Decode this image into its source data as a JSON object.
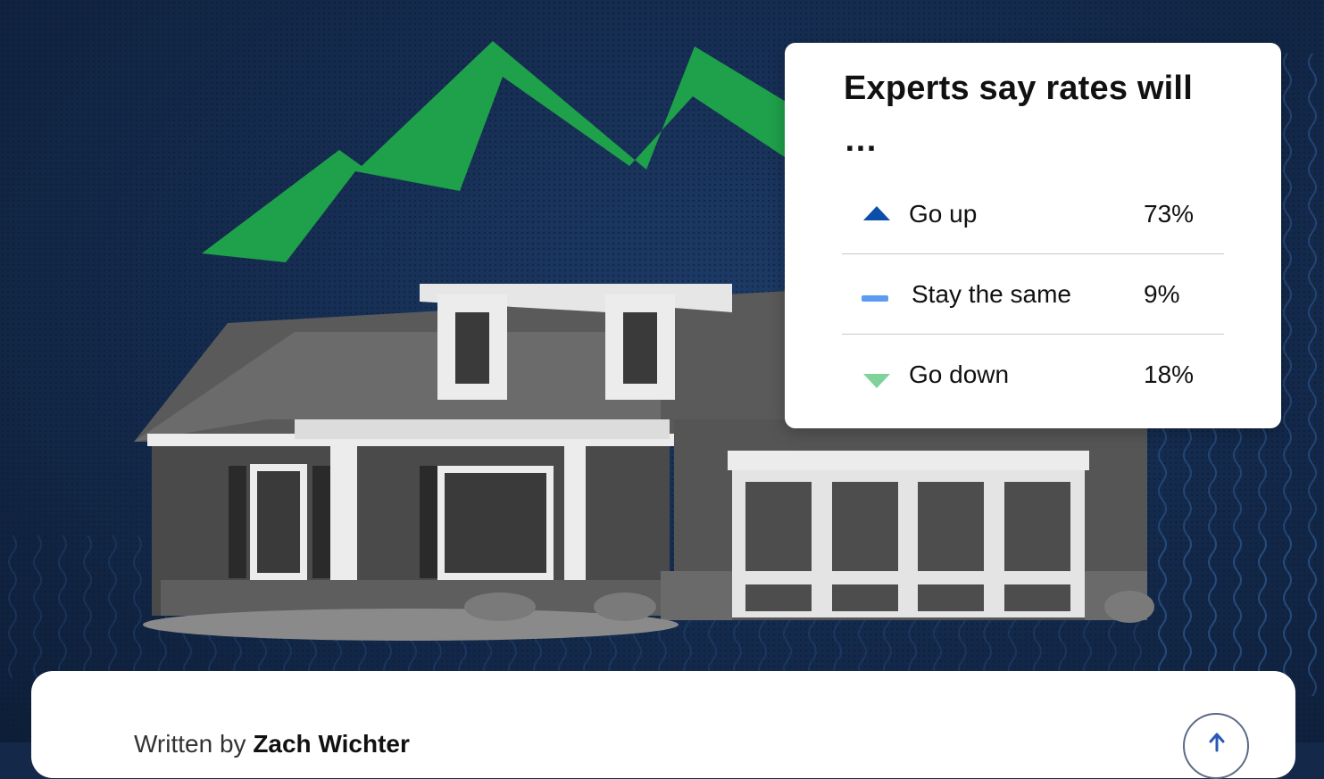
{
  "poll": {
    "title": "Experts say rates will …",
    "options": [
      {
        "label": "Go up",
        "value": "73%",
        "icon": "triangle-up-icon",
        "color": "#0b4fa8"
      },
      {
        "label": "Stay the same",
        "value": "9%",
        "icon": "dash-icon",
        "color": "#5b9cf0"
      },
      {
        "label": "Go down",
        "value": "18%",
        "icon": "triangle-down-icon",
        "color": "#7fd39a"
      }
    ]
  },
  "article": {
    "byline_prefix": "Written by",
    "author": "Zach Wichter"
  },
  "colors": {
    "background": "#14294a",
    "trend_line": "#1fa04a",
    "card": "#ffffff"
  }
}
